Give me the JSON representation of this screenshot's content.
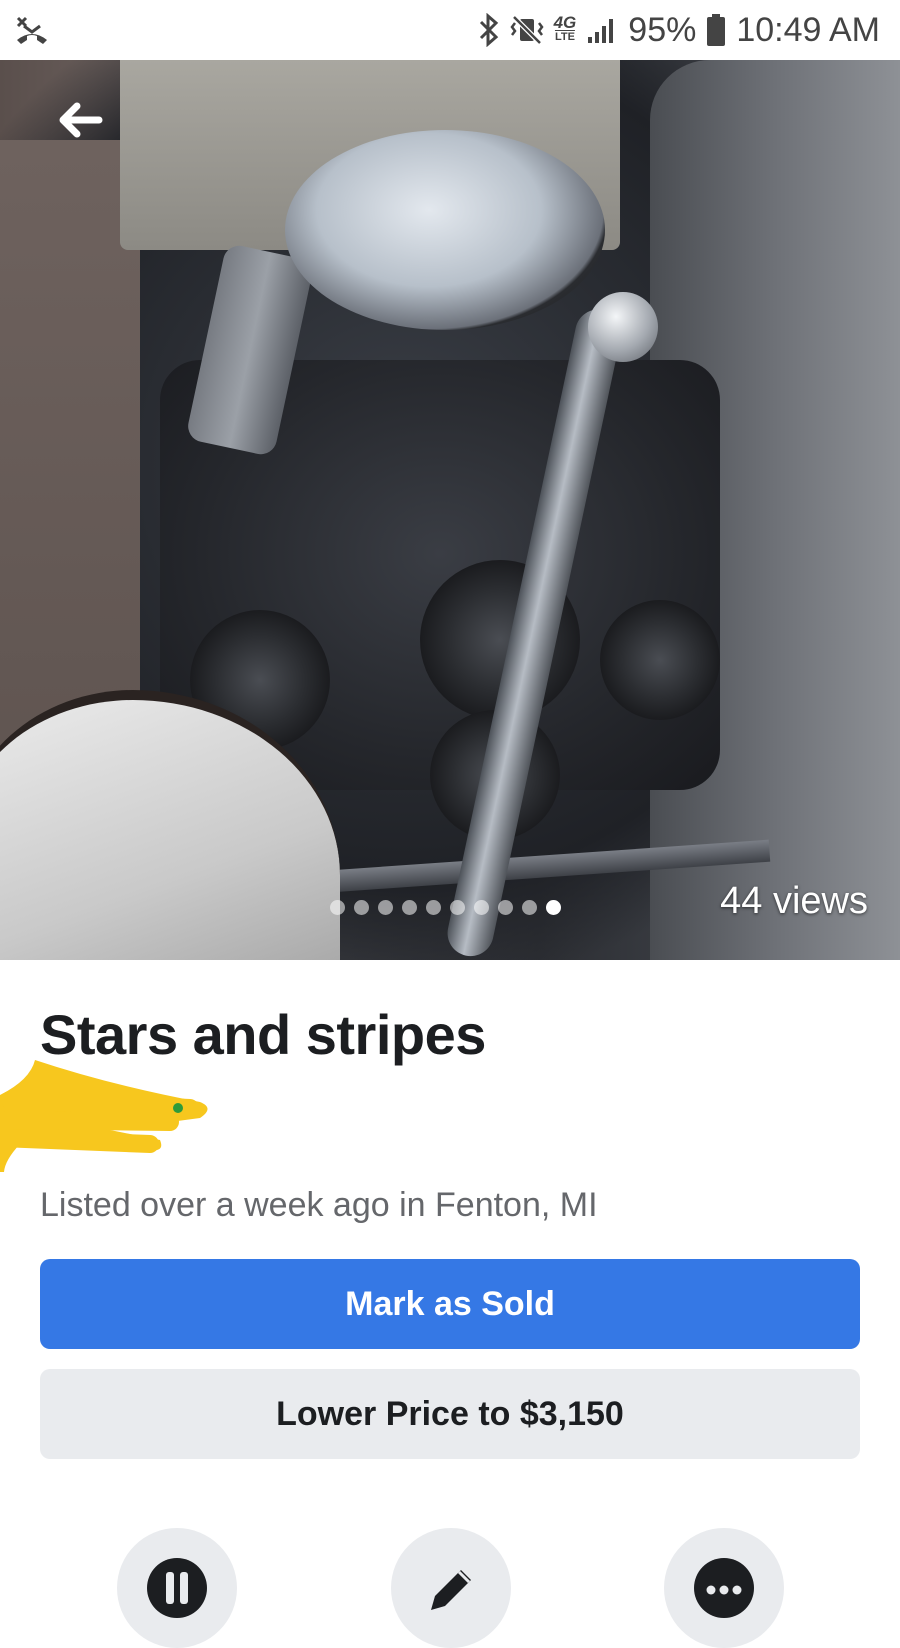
{
  "status_bar": {
    "battery_percent_label": "95%",
    "time": "10:49 AM",
    "network_label": "4G",
    "network_sub": "LTE",
    "icons": [
      "missed-call-icon",
      "bluetooth-icon",
      "vibrate-mute-icon",
      "signal-icon",
      "battery-icon"
    ]
  },
  "photo": {
    "views_label": "44 views",
    "carousel": {
      "total": 10,
      "active_index": 9
    }
  },
  "listing": {
    "title": "Stars and stripes",
    "listed_text": "Listed over a week ago in Fenton, MI"
  },
  "buttons": {
    "mark_sold": "Mark as Sold",
    "lower_price": "Lower Price to $3,150"
  },
  "colors": {
    "primary_button": "#3578e5",
    "secondary_button": "#e9ebee",
    "redaction": "#f7c71e"
  },
  "action_icons": [
    "pause-icon",
    "edit-pencil-icon",
    "more-options-icon"
  ]
}
